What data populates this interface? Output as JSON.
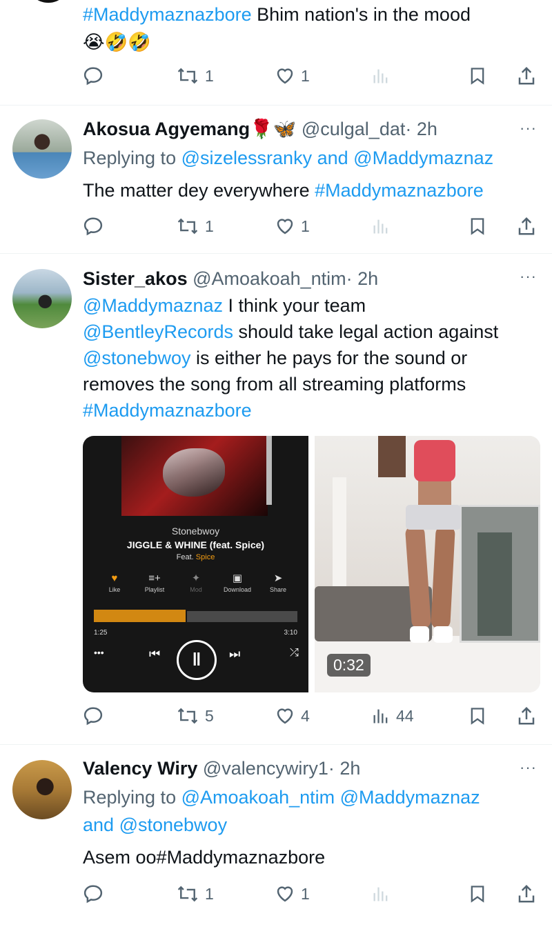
{
  "tweets": [
    {
      "text_parts": [
        {
          "t": "#Maddymaznazbore",
          "link": true
        },
        {
          "t": " Bhim nation's in the mood",
          "link": false
        }
      ],
      "emojis": "😭🤣🤣",
      "replies": "",
      "retweets": "1",
      "likes": "1",
      "views": ""
    },
    {
      "name": "Akosua Agyemang",
      "name_emoji": "🌹🦋",
      "handle": "@culgal_dat",
      "time": "· 2h",
      "replying_label": "Replying to",
      "replying_to_1": "@sizelessranky",
      "replying_and": "and",
      "replying_to_2": "@Maddymaznaz",
      "text_prefix": "The matter dey everywhere ",
      "text_hashtag": "#Maddymaznazbore",
      "retweets": "1",
      "likes": "1",
      "views": ""
    },
    {
      "name": "Sister_akos",
      "handle": "@Amoakoah_ntim",
      "time": "· 2h",
      "text_lines": [
        [
          {
            "t": "@Maddymaznaz",
            "link": true
          },
          {
            "t": " I think your team",
            "link": false
          }
        ],
        [
          {
            "t": "@BentleyRecords",
            "link": true
          },
          {
            "t": " should take legal action against",
            "link": false
          }
        ],
        [
          {
            "t": "@stonebwoy",
            "link": true
          },
          {
            "t": " is either he pays for the sound or",
            "link": false
          }
        ],
        [
          {
            "t": "removes the song from all streaming platforms",
            "link": false
          }
        ],
        [
          {
            "t": "#Maddymaznazbore",
            "link": true
          }
        ]
      ],
      "media": {
        "player": {
          "artist": "Stonebwoy",
          "title": "JIGGLE & WHINE (feat. Spice)",
          "feat_label": "Feat.",
          "feat_name": "Spice",
          "controls": [
            "Like",
            "Playlist",
            "Mod",
            "Download",
            "Share"
          ],
          "elapsed": "1:25",
          "total": "3:10",
          "accent": "#f39c12"
        },
        "video_duration": "0:32"
      },
      "retweets": "5",
      "likes": "4",
      "views": "44"
    },
    {
      "name": "Valency Wiry",
      "handle": "@valencywiry1",
      "time": "· 2h",
      "replying_label": "Replying to",
      "replying_to_1": "@Amoakoah_ntim",
      "replying_to_2": "@Maddymaznaz",
      "replying_and": "and",
      "replying_to_3": "@stonebwoy",
      "text": "Asem oo#Maddymaznazbore",
      "retweets": "1",
      "likes": "1",
      "views": ""
    }
  ],
  "more_glyph": "···",
  "colors": {
    "link": "#1d9bf0",
    "muted": "#536471",
    "divider": "#eff3f4"
  }
}
